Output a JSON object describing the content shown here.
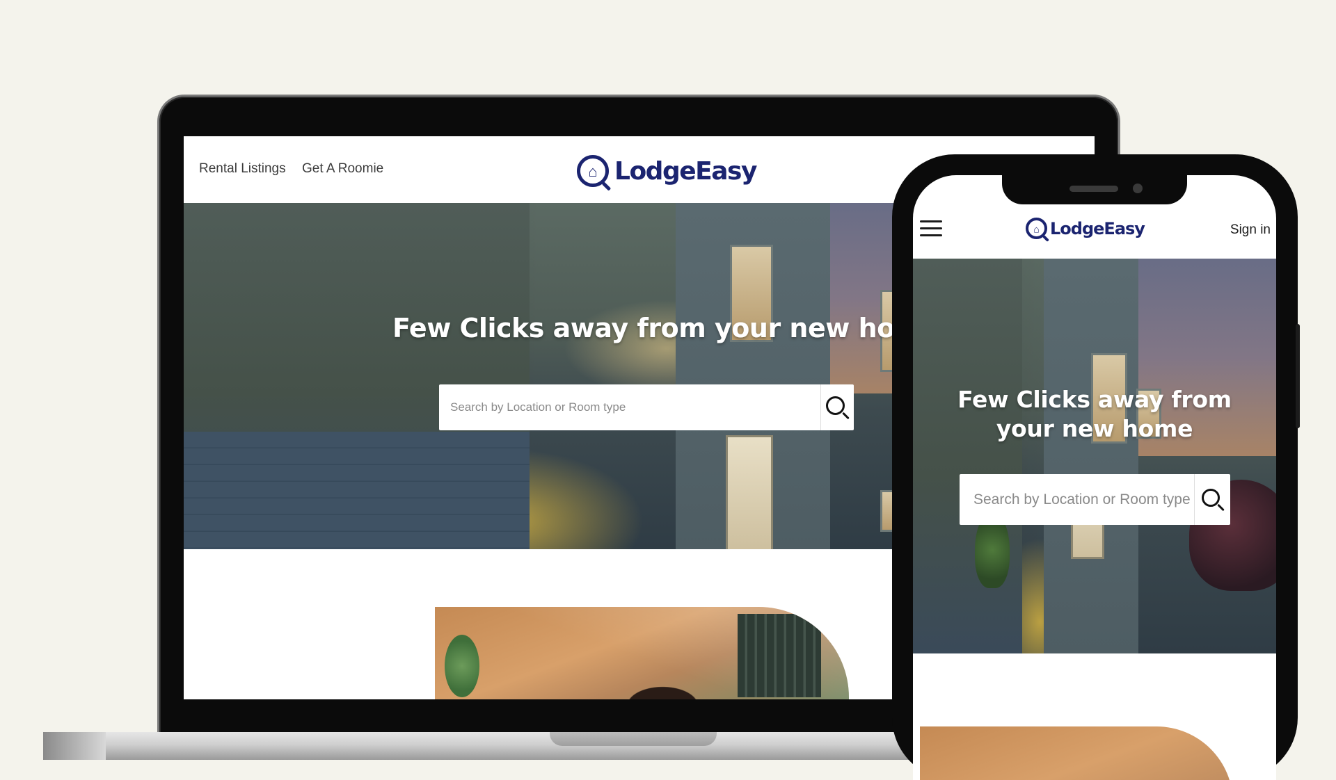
{
  "background_color": "#F4F3EC",
  "brand": {
    "name": "LodgeEasy",
    "color": "#1b2470"
  },
  "desktop": {
    "nav": {
      "links": [
        "Rental Listings",
        "Get A Roomie"
      ]
    },
    "hero": {
      "title": "Few Clicks away from your new home",
      "search_placeholder": "Search by Location or Room type"
    }
  },
  "mobile": {
    "nav": {
      "menu_icon": "hamburger-icon",
      "signin_label": "Sign in"
    },
    "hero": {
      "title": "Few Clicks away from your new home",
      "search_placeholder": "Search by Location or Room type"
    }
  },
  "icons": {
    "search": "magnifier-icon",
    "logo": "house-magnifier-logo"
  }
}
